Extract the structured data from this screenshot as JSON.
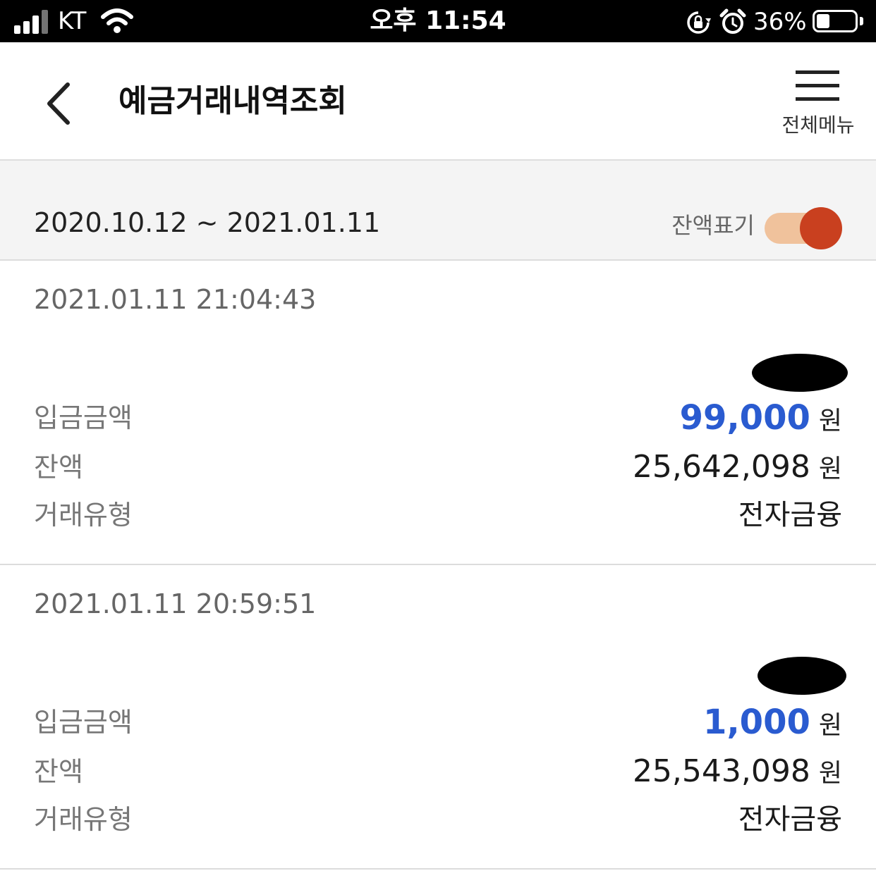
{
  "status_bar": {
    "carrier": "KT",
    "time": "오후 11:54",
    "battery": "36%",
    "battery_level": 0.36
  },
  "header": {
    "title": "예금거래내역조회",
    "menu_label": "전체메뉴"
  },
  "filter": {
    "date_range": "2020.10.12 ~ 2021.01.11",
    "balance_toggle_label": "잔액표기",
    "balance_toggle_on": true
  },
  "colors": {
    "accent": "#c9401f",
    "toggle_track": "#f0c29c",
    "amount_blue": "#2a5bd0"
  },
  "transactions": [
    {
      "datetime": "2021.01.11 21:04:43",
      "deposit_label": "입금금액",
      "deposit_amount": "99,000",
      "deposit_unit": "원",
      "balance_label": "잔액",
      "balance": "25,642,098",
      "balance_unit": "원",
      "type_label": "거래유형",
      "type": "전자금융"
    },
    {
      "datetime": "2021.01.11 20:59:51",
      "deposit_label": "입금금액",
      "deposit_amount": "1,000",
      "deposit_unit": "원",
      "balance_label": "잔액",
      "balance": "25,543,098",
      "balance_unit": "원",
      "type_label": "거래유형",
      "type": "전자금융"
    }
  ]
}
